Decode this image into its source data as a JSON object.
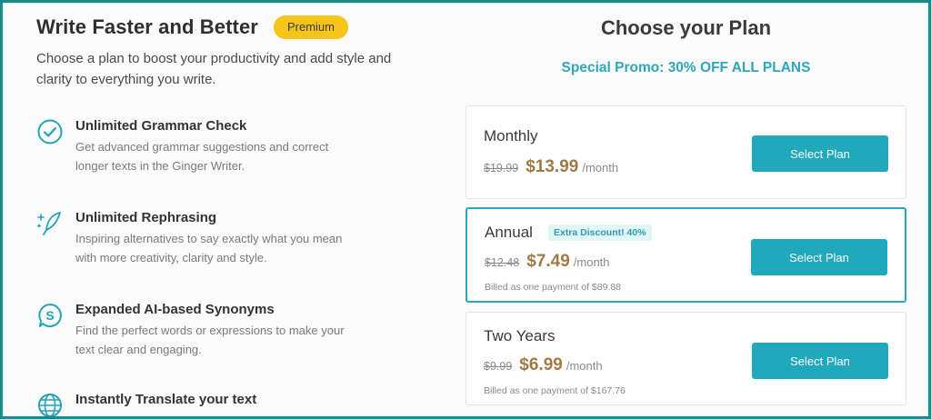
{
  "left": {
    "headline": "Write Faster and Better",
    "badge": "Premium",
    "subtitle": "Choose a plan to boost your productivity and add style and clarity to everything you write.",
    "features": [
      {
        "icon": "check-circle-icon",
        "title": "Unlimited Grammar Check",
        "desc": "Get advanced grammar suggestions and correct longer texts in the Ginger Writer."
      },
      {
        "icon": "sparkle-feather-icon",
        "title": "Unlimited Rephrasing",
        "desc": "Inspiring alternatives to say exactly what you mean with more creativity, clarity and style."
      },
      {
        "icon": "synonyms-s-bubble-icon",
        "title": "Expanded AI-based Synonyms",
        "desc": "Find the perfect words or expressions to make your text clear and engaging."
      },
      {
        "icon": "globe-icon",
        "title": "Instantly Translate your text",
        "desc": ""
      }
    ]
  },
  "right": {
    "title": "Choose your Plan",
    "promo": "Special Promo: 30% OFF ALL PLANS",
    "plans": [
      {
        "name": "Monthly",
        "old_price": "$19.99",
        "price": "$13.99",
        "period": "/month",
        "extra": "",
        "billed": "",
        "button": "Select Plan"
      },
      {
        "name": "Annual",
        "old_price": "$12.48",
        "price": "$7.49",
        "period": "/month",
        "extra": "Extra Discount! 40%",
        "billed": "Billed as one payment of $89.88",
        "button": "Select Plan"
      },
      {
        "name": "Two Years",
        "old_price": "$9.99",
        "price": "$6.99",
        "period": "/month",
        "extra": "",
        "billed": "Billed as one payment of $167.76",
        "button": "Select Plan"
      }
    ]
  },
  "colors": {
    "accent": "#20a8bc",
    "promo": "#2ea7b8",
    "price": "#a07b45",
    "badge": "#f5c518",
    "frame": "#168c8c"
  }
}
